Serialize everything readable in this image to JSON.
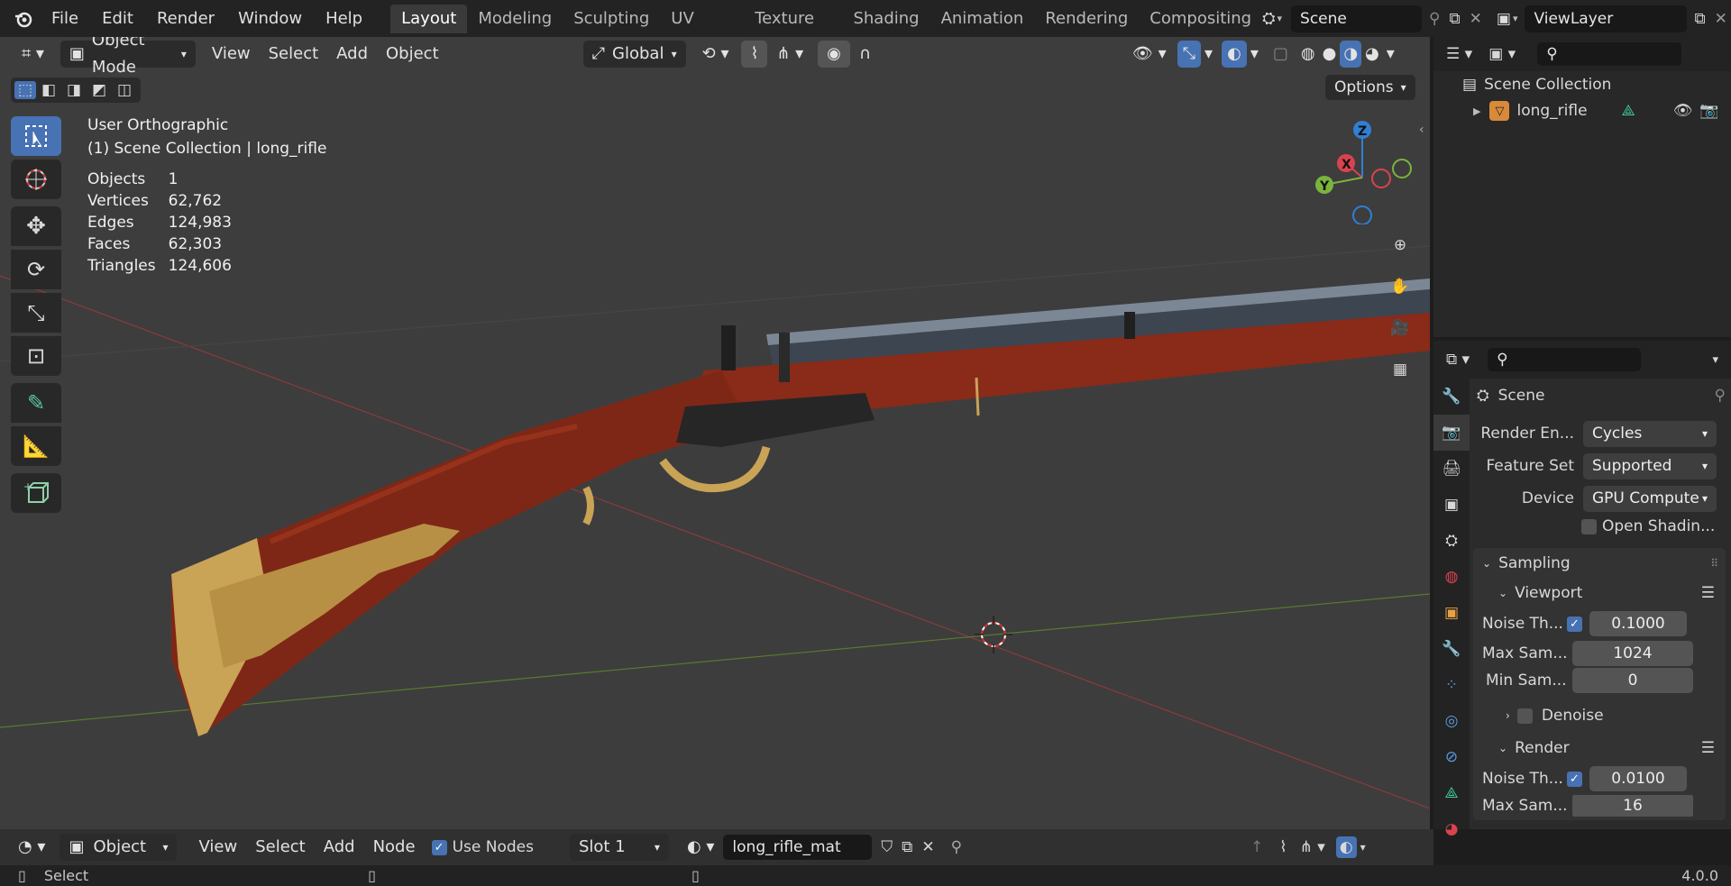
{
  "topbar": {
    "menus": [
      "File",
      "Edit",
      "Render",
      "Window",
      "Help"
    ],
    "workspaces": [
      "Layout",
      "Modeling",
      "Sculpting",
      "UV Editing",
      "Texture Paint",
      "Shading",
      "Animation",
      "Rendering",
      "Compositing"
    ],
    "active_workspace": "Layout",
    "scene_name": "Scene",
    "view_layer": "ViewLayer"
  },
  "viewport": {
    "mode": "Object Mode",
    "menus": [
      "View",
      "Select",
      "Add",
      "Object"
    ],
    "transform_orientation": "Global",
    "options_label": "Options",
    "view_name": "User Orthographic",
    "collection_path": "(1) Scene Collection | long_rifle",
    "stats": [
      {
        "label": "Objects",
        "value": "1"
      },
      {
        "label": "Vertices",
        "value": "62,762"
      },
      {
        "label": "Edges",
        "value": "124,983"
      },
      {
        "label": "Faces",
        "value": "62,303"
      },
      {
        "label": "Triangles",
        "value": "124,606"
      }
    ],
    "gizmo_axes": {
      "z": "Z",
      "x": "X",
      "y": "Y"
    },
    "tools": [
      "select-box",
      "cursor",
      "move",
      "rotate",
      "scale",
      "transform",
      "annotate",
      "measure",
      "add-cube"
    ]
  },
  "outliner": {
    "root": "Scene Collection",
    "items": [
      {
        "name": "long_rifle"
      }
    ]
  },
  "properties": {
    "context": "Scene",
    "render_engine_label": "Render En...",
    "render_engine": "Cycles",
    "feature_set_label": "Feature Set",
    "feature_set": "Supported",
    "device_label": "Device",
    "device": "GPU Compute",
    "open_shading_label": "Open Shadin...",
    "sampling_label": "Sampling",
    "viewport_label": "Viewport",
    "render_label": "Render",
    "denoise_label": "Denoise",
    "viewport_noise_label": "Noise Th...",
    "viewport_noise": "0.1000",
    "viewport_max_label": "Max Sam...",
    "viewport_max": "1024",
    "viewport_min_label": "Min Sam...",
    "viewport_min": "0",
    "render_noise_label": "Noise Th...",
    "render_noise": "0.0100",
    "render_max_label": "Max Sam...",
    "render_max": "16"
  },
  "node_editor": {
    "object_dropdown": "Object",
    "menus": [
      "View",
      "Select",
      "Add",
      "Node"
    ],
    "use_nodes_label": "Use Nodes",
    "slot": "Slot 1",
    "material": "long_rifle_mat"
  },
  "statusbar": {
    "left_hint": "Select",
    "version": "4.0.0"
  },
  "colors": {
    "accent": "#4772b3",
    "viewport_bg": "#3d3d3d",
    "x_axis": "#d9434f",
    "y_axis": "#7ab33e",
    "z_axis": "#2f7fd5",
    "wood": "#8e2d1c",
    "brass": "#c9a356"
  }
}
